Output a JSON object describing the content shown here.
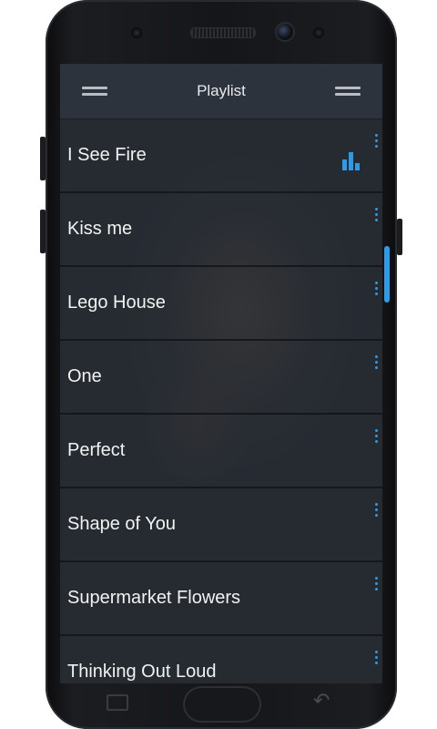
{
  "header": {
    "title": "Playlist",
    "left_icon": "menu-icon",
    "right_icon": "menu-icon"
  },
  "playlist": [
    {
      "title": "I See Fire",
      "playing": true
    },
    {
      "title": "Kiss me",
      "playing": false
    },
    {
      "title": "Lego House",
      "playing": false
    },
    {
      "title": "One",
      "playing": false
    },
    {
      "title": "Perfect",
      "playing": false
    },
    {
      "title": "Shape of You",
      "playing": false
    },
    {
      "title": "Supermarket Flowers",
      "playing": false
    },
    {
      "title": "Thinking Out Loud",
      "playing": false
    }
  ],
  "icons": {
    "more": "more-vertical-icon",
    "now_playing": "equalizer-icon"
  },
  "colors": {
    "accent": "#2f9ae8",
    "header_bg": "#2e343d",
    "text": "#f2f2f2"
  }
}
